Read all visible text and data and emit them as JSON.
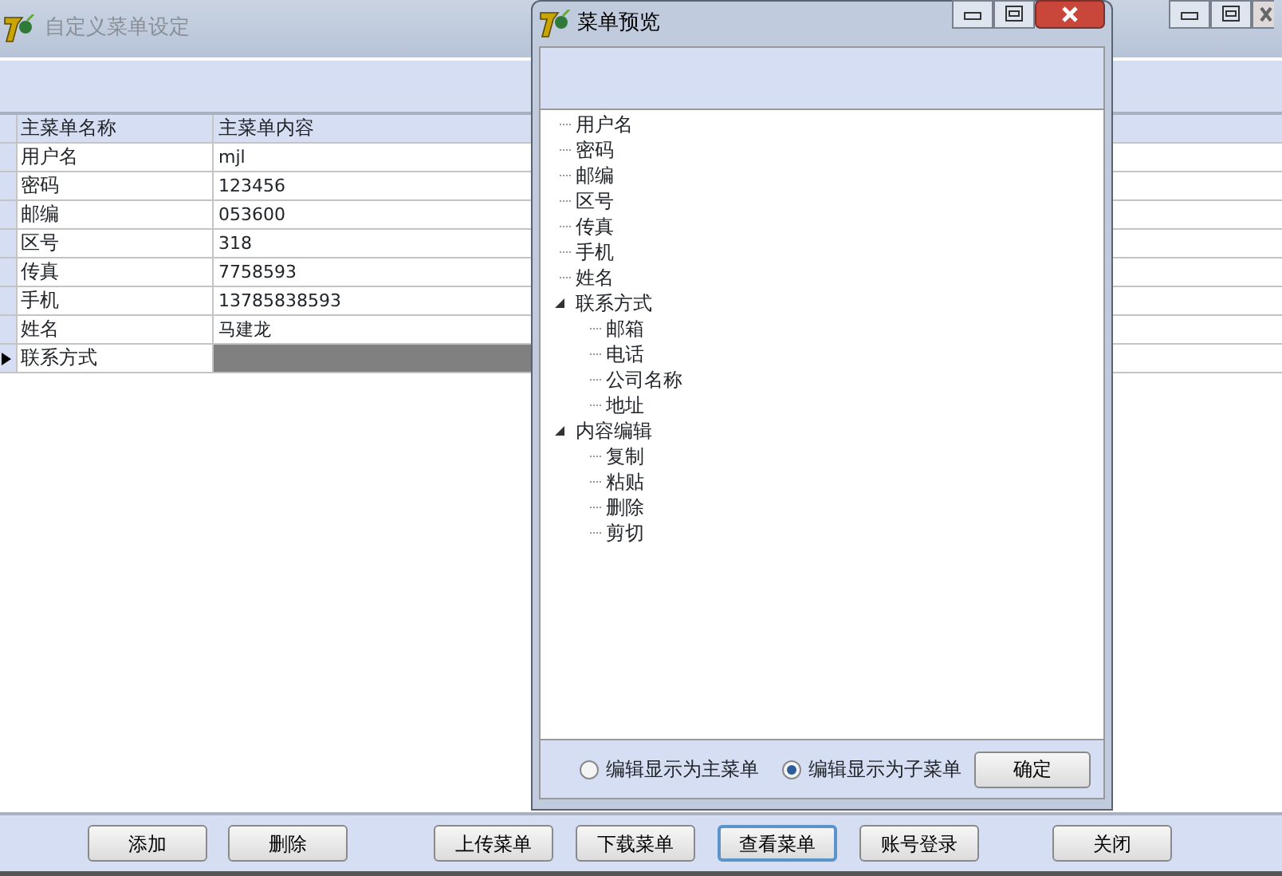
{
  "main_window": {
    "title": "自定义菜单设定",
    "grid": {
      "columns": [
        "主菜单名称",
        "主菜单内容"
      ],
      "rows": [
        {
          "name": "用户名",
          "content": "mjl",
          "current": false
        },
        {
          "name": "密码",
          "content": "123456",
          "current": false
        },
        {
          "name": "邮编",
          "content": "053600",
          "current": false
        },
        {
          "name": "区号",
          "content": "318",
          "current": false
        },
        {
          "name": "传真",
          "content": "7758593",
          "current": false
        },
        {
          "name": "手机",
          "content": "13785838593",
          "current": false
        },
        {
          "name": "姓名",
          "content": "马建龙",
          "current": false
        },
        {
          "name": "联系方式",
          "content": "",
          "current": true
        }
      ]
    },
    "buttons": [
      {
        "label": "添加",
        "focused": false
      },
      {
        "label": "删除",
        "focused": false
      },
      {
        "label": "上传菜单",
        "focused": false
      },
      {
        "label": "下载菜单",
        "focused": false
      },
      {
        "label": "查看菜单",
        "focused": true
      },
      {
        "label": "账号登录",
        "focused": false
      },
      {
        "label": "关闭",
        "focused": false
      }
    ]
  },
  "preview_dialog": {
    "title": "菜单预览",
    "tree": [
      {
        "label": "用户名"
      },
      {
        "label": "密码"
      },
      {
        "label": "邮编"
      },
      {
        "label": "区号"
      },
      {
        "label": "传真"
      },
      {
        "label": "手机"
      },
      {
        "label": "姓名"
      },
      {
        "label": "联系方式",
        "expanded": true,
        "children": [
          {
            "label": "邮箱"
          },
          {
            "label": "电话"
          },
          {
            "label": "公司名称"
          },
          {
            "label": "地址"
          }
        ]
      },
      {
        "label": "内容编辑",
        "expanded": true,
        "children": [
          {
            "label": "复制"
          },
          {
            "label": "粘贴"
          },
          {
            "label": "删除"
          },
          {
            "label": "剪切"
          }
        ]
      }
    ],
    "options": [
      {
        "label": "编辑显示为主菜单",
        "selected": false
      },
      {
        "label": "编辑显示为子菜单",
        "selected": true
      }
    ],
    "ok_button": "确定"
  }
}
